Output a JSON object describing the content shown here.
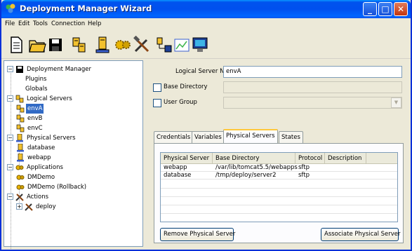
{
  "window": {
    "title": "Deployment Manager Wizard"
  },
  "menu": [
    "File",
    "Edit",
    "Tools",
    "Connection",
    "Help"
  ],
  "toolbar_icons": [
    "new-document-icon",
    "open-folder-icon",
    "save-disk-icon",
    "logical-server-icon",
    "physical-server-icon",
    "application-gears-icon",
    "actions-tools-icon",
    "deploy-network-icon",
    "chart-report-icon",
    "monitor-icon"
  ],
  "tree": {
    "root": "Deployment Manager",
    "plugins": "Plugins",
    "globals": "Globals",
    "logical_servers": "Logical Servers",
    "env_a": "envA",
    "env_b": "envB",
    "env_c": "envC",
    "physical_servers": "Physical Servers",
    "database": "database",
    "webapp": "webapp",
    "applications": "Applications",
    "dmdemo": "DMDemo",
    "dmdemo_rollback": "DMDemo (Rollback)",
    "actions": "Actions",
    "deploy": "deploy"
  },
  "form": {
    "logical_server_name_label": "Logical Server Name",
    "logical_server_name_value": "envA",
    "base_directory_label": "Base Directory",
    "base_directory_value": "",
    "user_group_label": "User Group",
    "user_group_value": ""
  },
  "tabs": [
    "Credentials",
    "Variables",
    "Physical Servers",
    "States"
  ],
  "active_tab": "Physical Servers",
  "table": {
    "headers": [
      "Physical Server",
      "Base Directory",
      "Protocol",
      "Description"
    ],
    "rows": [
      [
        "webapp",
        "/var/lib/tomcat5.5/webapps",
        "sftp",
        ""
      ],
      [
        "database",
        "/tmp/deploy/server2",
        "sftp",
        ""
      ]
    ]
  },
  "buttons": {
    "remove": "Remove Physical Server",
    "associate": "Associate Physical Server"
  },
  "colors": {
    "titlebar": "#0053ee",
    "selection": "#316ac5",
    "window_bg": "#ece9d8"
  }
}
